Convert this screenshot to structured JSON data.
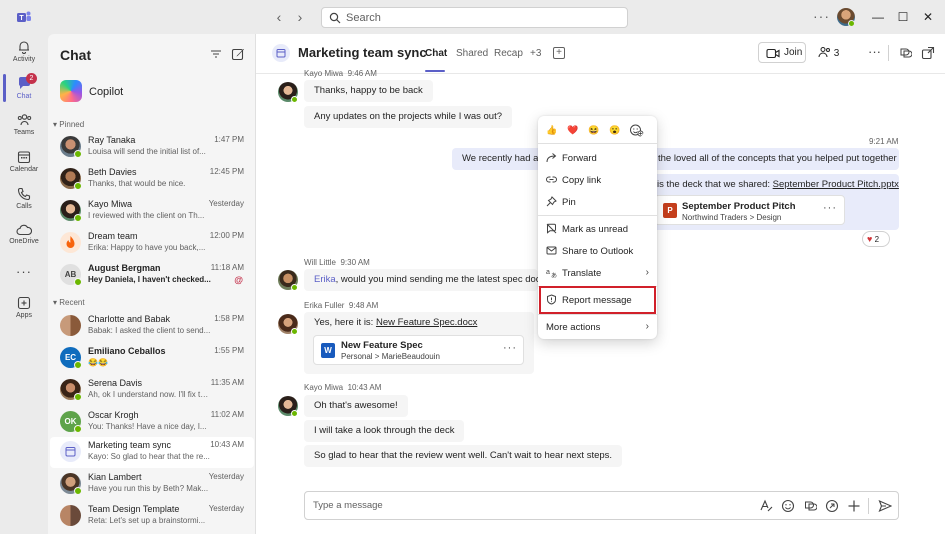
{
  "titlebar": {
    "search_placeholder": "Search",
    "more_label": "···",
    "window_controls": [
      "minimize",
      "maximize",
      "close"
    ]
  },
  "rail": {
    "items": [
      {
        "label": "Activity",
        "icon": "bell-icon"
      },
      {
        "label": "Chat",
        "icon": "chat-icon",
        "badge": "2",
        "active": true
      },
      {
        "label": "Teams",
        "icon": "teams-icon"
      },
      {
        "label": "Calendar",
        "icon": "calendar-icon"
      },
      {
        "label": "Calls",
        "icon": "phone-icon"
      },
      {
        "label": "OneDrive",
        "icon": "cloud-icon"
      },
      {
        "label": "···",
        "icon": "more-icon"
      },
      {
        "label": "Apps",
        "icon": "apps-icon"
      }
    ]
  },
  "chatlist": {
    "title": "Chat",
    "copilot_label": "Copilot",
    "pinned_label": "Pinned",
    "recent_label": "Recent",
    "pinned": [
      {
        "name": "Ray Tanaka",
        "time": "1:47 PM",
        "preview": "Louisa will send the initial list of...",
        "bold": false
      },
      {
        "name": "Beth Davies",
        "time": "12:45 PM",
        "preview": "Thanks, that would be nice.",
        "bold": false
      },
      {
        "name": "Kayo Miwa",
        "time": "Yesterday",
        "preview": "I reviewed with the client on Th...",
        "bold": false
      },
      {
        "name": "Dream team",
        "time": "12:00 PM",
        "preview": "Erika: Happy to have you back,...",
        "bold": false
      },
      {
        "name": "August Bergman",
        "time": "11:18 AM",
        "preview": "Hey Daniela, I haven't checked...",
        "bold": true,
        "initials": "AB"
      }
    ],
    "recent": [
      {
        "name": "Charlotte and Babak",
        "time": "1:58 PM",
        "preview": "Babak: I asked the client to send...",
        "bold": false
      },
      {
        "name": "Emiliano Ceballos",
        "time": "1:55 PM",
        "preview": "😂😂",
        "bold": true,
        "initials": "EC"
      },
      {
        "name": "Serena Davis",
        "time": "11:35 AM",
        "preview": "Ah, ok I understand now. I'll fix that!",
        "bold": false
      },
      {
        "name": "Oscar Krogh",
        "time": "11:02 AM",
        "preview": "You: Thanks! Have a nice day, I...",
        "bold": false,
        "initials": "OK"
      },
      {
        "name": "Marketing team sync",
        "time": "10:43 AM",
        "preview": "Kayo: So glad to hear that the re...",
        "bold": false
      },
      {
        "name": "Kian Lambert",
        "time": "Yesterday",
        "preview": "Have you run this by Beth? Mak...",
        "bold": false
      },
      {
        "name": "Team Design Template",
        "time": "Yesterday",
        "preview": "Reta: Let's set up a brainstormi...",
        "bold": false
      }
    ]
  },
  "main": {
    "title": "Marketing team sync",
    "tabs": [
      "Chat",
      "Shared",
      "Recap",
      "+3"
    ],
    "join_label": "Join",
    "participant_count": "3",
    "compose_placeholder": "Type a message"
  },
  "messages": {
    "kayo1_sender": "Kayo Miwa",
    "kayo1_time": "9:46 AM",
    "kayo1_a": "Thanks, happy to be back",
    "kayo1_b": "Any updates on the projects while I was out?",
    "mine_time": "9:21 AM",
    "mine_a_start": "We recently had a",
    "mine_a_end": "the loved all of the concepts that you helped put together",
    "mine_b_prefix": "is the deck that we shared: ",
    "mine_b_link": "September Product Pitch.pptx",
    "mine_file_name": "September Product Pitch",
    "mine_file_path": "Northwind Traders > Design",
    "reaction_count": "2",
    "will_sender": "Will Little",
    "will_time": "9:30 AM",
    "will_mention": "Erika",
    "will_text": ", would you mind sending me the latest spec doc a",
    "erika_sender": "Erika Fuller",
    "erika_time": "9:48 AM",
    "erika_prefix": "Yes, here it is: ",
    "erika_link": "New Feature Spec.docx",
    "erika_file_name": "New Feature Spec",
    "erika_file_path": "Personal > MarieBeaudouin",
    "kayo2_sender": "Kayo Miwa",
    "kayo2_time": "10:43 AM",
    "kayo2_a": "Oh that's awesome!",
    "kayo2_b": "I will take a look through the deck",
    "kayo2_c": "So glad to hear that the review went well. Can't wait to hear next steps."
  },
  "context_menu": {
    "emojis": [
      "👍",
      "❤️",
      "😆",
      "😮",
      "add-reaction"
    ],
    "forward": "Forward",
    "copy_link": "Copy link",
    "pin": "Pin",
    "mark_unread": "Mark as unread",
    "share_outlook": "Share to Outlook",
    "translate": "Translate",
    "report": "Report message",
    "more_actions": "More actions"
  },
  "colors": {
    "brand": "#5b5fc7",
    "highlight_box": "#d1202a",
    "presence_available": "#6bb700",
    "badge": "#c4314b"
  }
}
